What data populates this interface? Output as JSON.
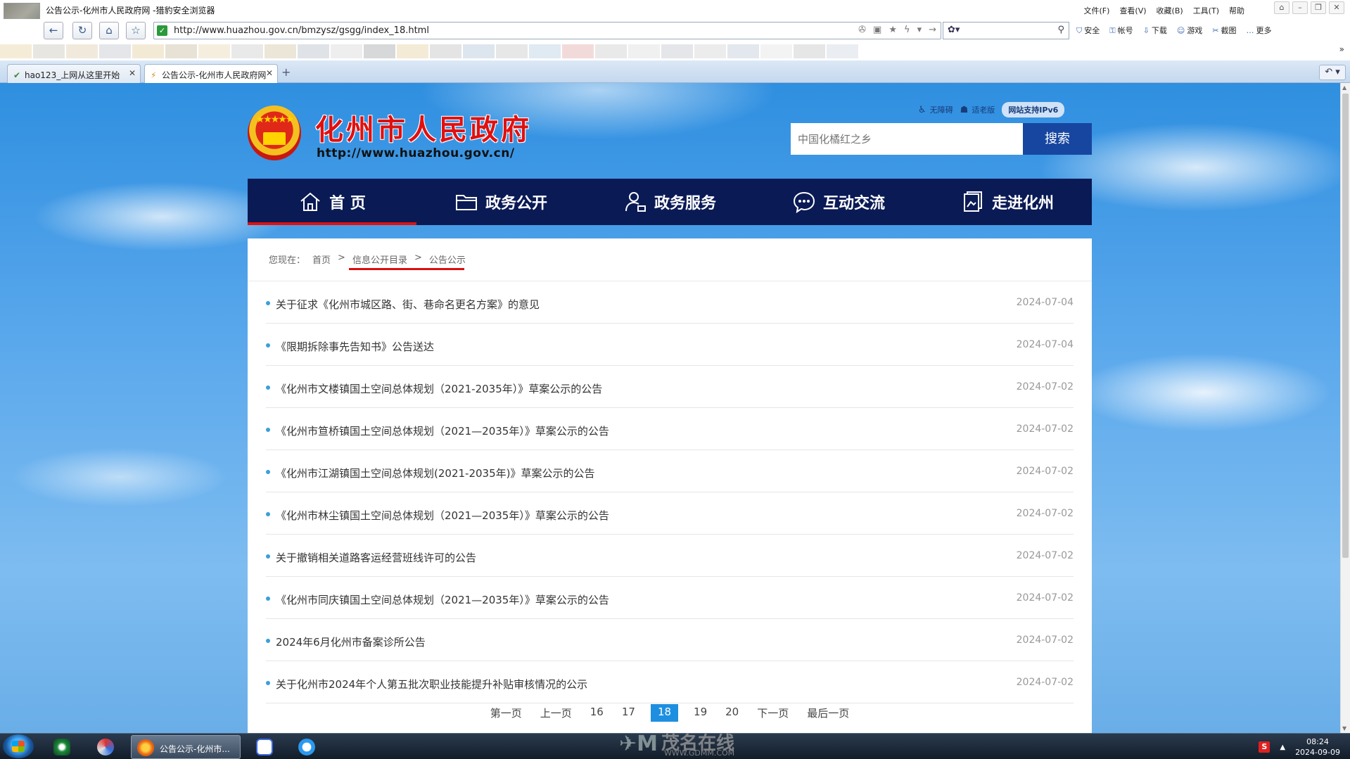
{
  "browser": {
    "window_title": "公告公示-化州市人民政府网 -猎豹安全浏览器",
    "menus": [
      "文件(F)",
      "查看(V)",
      "收藏(B)",
      "工具(T)",
      "帮助"
    ],
    "url": "http://www.huazhou.gov.cn/bmzysz/gsgg/index_18.html",
    "right_tools": [
      "安全",
      "帐号",
      "下载",
      "游戏",
      "截图",
      "更多"
    ],
    "tabs": [
      {
        "label": "hao123_上网从这里开始",
        "active": false
      },
      {
        "label": "公告公示-化州市人民政府网",
        "active": true
      }
    ]
  },
  "site": {
    "title": "化州市人民政府",
    "url_text": "http://www.huazhou.gov.cn/",
    "util": {
      "accessible": "无障碍",
      "elder": "适老版",
      "ipv6": "网站支持IPv6"
    },
    "search": {
      "placeholder": "中国化橘红之乡",
      "button": "搜索"
    },
    "nav": [
      {
        "label": "首 页",
        "icon": "home-icon",
        "active": true
      },
      {
        "label": "政务公开",
        "icon": "folder-icon",
        "active": false
      },
      {
        "label": "政务服务",
        "icon": "user-service-icon",
        "active": false
      },
      {
        "label": "互动交流",
        "icon": "chat-icon",
        "active": false
      },
      {
        "label": "走进化州",
        "icon": "city-icon",
        "active": false
      }
    ],
    "breadcrumb": {
      "prefix": "您现在：",
      "items": [
        "首页",
        "信息公开目录",
        "公告公示"
      ],
      "sep": ">"
    },
    "list": [
      {
        "title": "关于征求《化州市城区路、街、巷命名更名方案》的意见",
        "date": "2024-07-04"
      },
      {
        "title": "《限期拆除事先告知书》公告送达",
        "date": "2024-07-04"
      },
      {
        "title": "《化州市文楼镇国土空间总体规划（2021-2035年）》草案公示的公告",
        "date": "2024-07-02"
      },
      {
        "title": "《化州市笪桥镇国土空间总体规划（2021—2035年）》草案公示的公告",
        "date": "2024-07-02"
      },
      {
        "title": "《化州市江湖镇国土空间总体规划(2021-2035年)》草案公示的公告",
        "date": "2024-07-02"
      },
      {
        "title": "《化州市林尘镇国土空间总体规划（2021—2035年）》草案公示的公告",
        "date": "2024-07-02"
      },
      {
        "title": "关于撤销相关道路客运经营班线许可的公告",
        "date": "2024-07-02"
      },
      {
        "title": "《化州市同庆镇国土空间总体规划（2021—2035年）》草案公示的公告",
        "date": "2024-07-02"
      },
      {
        "title": "2024年6月化州市备案诊所公告",
        "date": "2024-07-02"
      },
      {
        "title": "关于化州市2024年个人第五批次职业技能提升补贴审核情况的公示",
        "date": "2024-07-02"
      }
    ],
    "pager": [
      "第一页",
      "上一页",
      "16",
      "17",
      "18",
      "19",
      "20",
      "下一页",
      "最后一页"
    ],
    "current_page": "18"
  },
  "watermark": {
    "brand": "茂名在线",
    "domain": "WWW.GDMM.COM"
  },
  "taskbar": {
    "active_label": "公告公示-化州市...",
    "time": "08:24",
    "date": "2024-09-09"
  },
  "colors": {
    "nav_bg": "#0a1a55",
    "accent_red": "#e01010",
    "search_btn": "#1746a0",
    "current_page": "#1e8fe0"
  }
}
